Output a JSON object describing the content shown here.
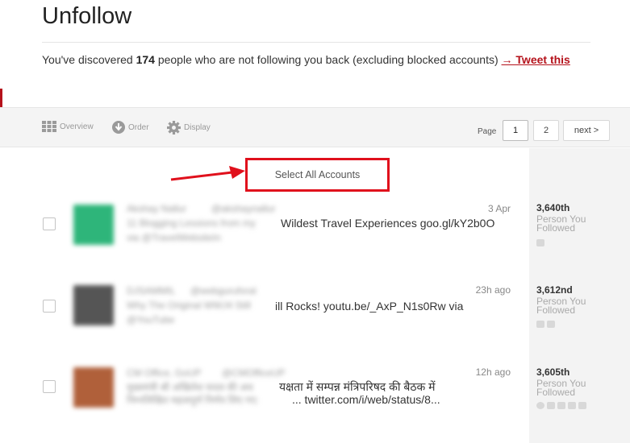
{
  "header": {
    "title": "Unfollow",
    "summary_prefix": "You've discovered ",
    "count": "174",
    "summary_suffix": " people who are not following you back (excluding blocked accounts) ",
    "tweet_link": "→ Tweet this"
  },
  "toolbar": {
    "overview": "Overview",
    "order": "Order",
    "display": "Display",
    "page_label": "Page",
    "pages": [
      "1",
      "2"
    ],
    "next": "next >"
  },
  "select_all_label": "Select All Accounts",
  "accounts": [
    {
      "name": "Akshay Nallur",
      "handle": "@akshaynallur",
      "tweet_blur_1": "11 Blogging Lessions from my",
      "tweet_visible_1": "Wildest Travel Experiences goo.gl/kY2b0O",
      "tweet_blur_2": "via @TravelWebsiteIn",
      "tweet_visible_2": "",
      "time": "3 Apr",
      "rank": "3,640th",
      "rank_sub": "Person You Followed",
      "avatar_color": "#2eb57a"
    },
    {
      "name": "DJSAMMIL",
      "handle": "@webguruforal",
      "tweet_blur_1": "Why The Original WWJ4 Still",
      "tweet_visible_1": "ill Rocks! youtu.be/_AxP_N1s0Rw via",
      "tweet_blur_2": "@YouTube",
      "tweet_visible_2": "",
      "time": "23h ago",
      "rank": "3,612nd",
      "rank_sub": "Person You Followed",
      "avatar_color": "#555555"
    },
    {
      "name": "CM Office, GoUP",
      "handle": "@CMOfficeUP",
      "tweet_blur_1": "मुख्यमंत्री श्री अखिलेश यादव की अध",
      "tweet_visible_1": "यक्षता में सम्पन्न मंत्रिपरिषद की बैठक में",
      "tweet_blur_2": "निम्नलिखित महत्वपूर्ण निर्णय लिए गए:",
      "tweet_visible_2": "... twitter.com/i/web/status/8...",
      "time": "12h ago",
      "rank": "3,605th",
      "rank_sub": "Person You Followed",
      "avatar_color": "#b0603a"
    }
  ]
}
